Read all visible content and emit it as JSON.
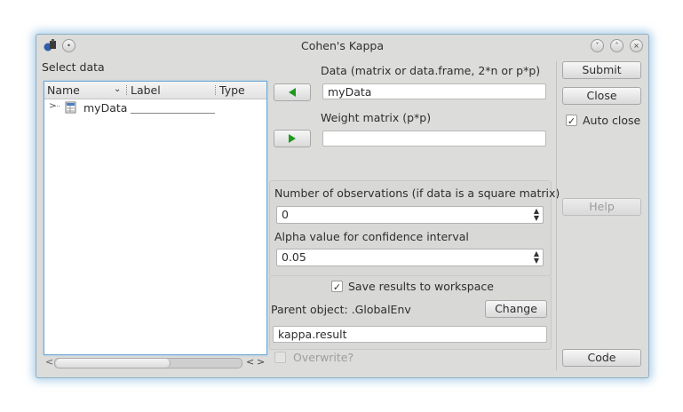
{
  "window": {
    "title": "Cohen's Kappa"
  },
  "left": {
    "select_label": "Select data",
    "columns": [
      "Name",
      "Label",
      "Type"
    ],
    "rows": [
      {
        "name": "myData",
        "label": "",
        "type": ""
      }
    ]
  },
  "data_field": {
    "label": "Data (matrix or data.frame, 2*n or p*p)",
    "value": "myData"
  },
  "weight_field": {
    "label": "Weight matrix (p*p)",
    "value": ""
  },
  "observations": {
    "label": "Number of observations (if data is a square matrix)",
    "value": "0"
  },
  "alpha": {
    "label": "Alpha value for confidence interval",
    "value": "0.05"
  },
  "save": {
    "checkbox_label": "Save results to workspace",
    "checked": true,
    "parent_label": "Parent object: .GlobalEnv",
    "change_label": "Change",
    "object_name": "kappa.result",
    "overwrite_label": "Overwrite?"
  },
  "buttons": {
    "submit": "Submit",
    "close": "Close",
    "auto_close": "Auto close",
    "help": "Help",
    "code": "Code"
  },
  "colors": {
    "accent": "#6fa9d6",
    "arrow_green": "#1f9a1f"
  }
}
